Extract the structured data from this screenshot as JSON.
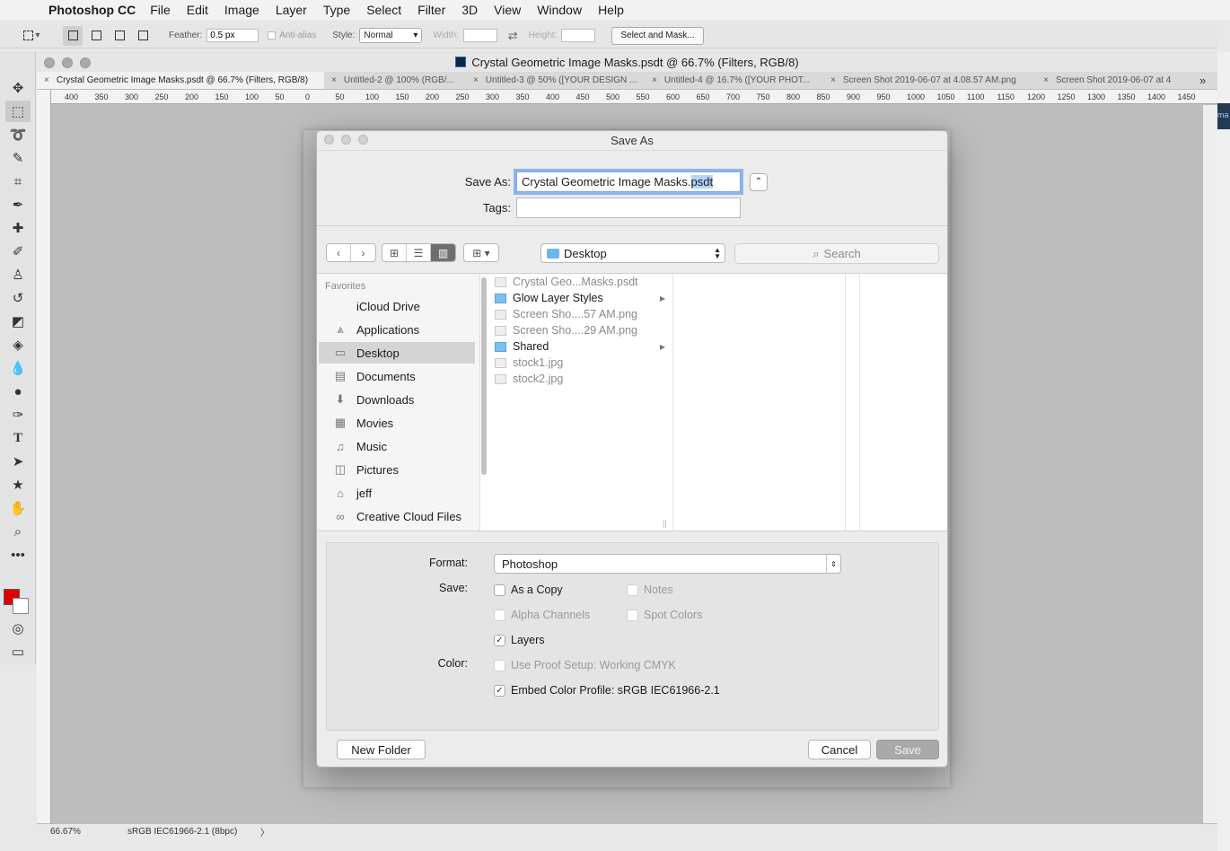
{
  "menubar": {
    "app": "Photoshop CC",
    "items": [
      "File",
      "Edit",
      "Image",
      "Layer",
      "Type",
      "Select",
      "Filter",
      "3D",
      "View",
      "Window",
      "Help"
    ]
  },
  "options": {
    "feather_label": "Feather:",
    "feather_value": "0.5 px",
    "antialias_label": "Anti-alias",
    "style_label": "Style:",
    "style_value": "Normal",
    "width_label": "Width:",
    "height_label": "Height:",
    "select_mask": "Select and Mask..."
  },
  "document": {
    "title": "Crystal Geometric Image Masks.psdt @ 66.7% (Filters, RGB/8)",
    "tabs": [
      "Crystal Geometric Image Masks.psdt @ 66.7% (Filters, RGB/8)",
      "Untitled-2 @ 100% (RGB/...",
      "Untitled-3 @ 50% ([YOUR DESIGN ...",
      "Untitled-4 @ 16.7% ([YOUR PHOT...",
      "Screen Shot 2019-06-07 at 4.08.57 AM.png",
      "Screen Shot 2019-06-07 at 4"
    ],
    "ruler": [
      "400",
      "350",
      "300",
      "250",
      "200",
      "150",
      "100",
      "50",
      "0",
      "50",
      "100",
      "150",
      "200",
      "250",
      "300",
      "350",
      "400",
      "450",
      "500",
      "550",
      "600",
      "650",
      "700",
      "750",
      "800",
      "850",
      "900",
      "950",
      "1000",
      "1050",
      "1100",
      "1150",
      "1200",
      "1250",
      "1300",
      "1350",
      "1400",
      "1450"
    ],
    "zoom": "66.67%",
    "profile": "sRGB IEC61966-2.1 (8bpc)",
    "right_edge": "ma"
  },
  "dialog": {
    "title": "Save As",
    "save_as_label": "Save As:",
    "filename_base": "Crystal Geometric Image Masks.",
    "filename_ext": "psdt",
    "tags_label": "Tags:",
    "location": "Desktop",
    "search_placeholder": "Search",
    "favorites_label": "Favorites",
    "sidebar": [
      {
        "label": "iCloud Drive",
        "icon": "cloud-icon"
      },
      {
        "label": "Applications",
        "icon": "applications-icon"
      },
      {
        "label": "Desktop",
        "icon": "desktop-icon"
      },
      {
        "label": "Documents",
        "icon": "documents-icon"
      },
      {
        "label": "Downloads",
        "icon": "downloads-icon"
      },
      {
        "label": "Movies",
        "icon": "movies-icon"
      },
      {
        "label": "Music",
        "icon": "music-icon"
      },
      {
        "label": "Pictures",
        "icon": "pictures-icon"
      },
      {
        "label": "jeff",
        "icon": "home-icon"
      },
      {
        "label": "Creative Cloud Files",
        "icon": "creative-cloud-icon"
      }
    ],
    "files": [
      {
        "name": "Crystal Geo...Masks.psdt",
        "kind": "file",
        "dim": true
      },
      {
        "name": "Glow Layer Styles",
        "kind": "folder",
        "dim": false
      },
      {
        "name": "Screen Sho....57 AM.png",
        "kind": "file",
        "dim": true
      },
      {
        "name": "Screen Sho....29 AM.png",
        "kind": "file",
        "dim": true
      },
      {
        "name": "Shared",
        "kind": "folder",
        "dim": false
      },
      {
        "name": "stock1.jpg",
        "kind": "file",
        "dim": true
      },
      {
        "name": "stock2.jpg",
        "kind": "file",
        "dim": true
      }
    ],
    "format_label": "Format:",
    "format_value": "Photoshop",
    "save_label": "Save:",
    "color_label": "Color:",
    "checkbox_labels": {
      "as_a_copy": "As a Copy",
      "notes": "Notes",
      "alpha": "Alpha Channels",
      "spot": "Spot Colors",
      "layers": "Layers",
      "proof": "Use Proof Setup:  Working CMYK",
      "embed": "Embed Color Profile:  sRGB IEC61966-2.1"
    },
    "new_folder": "New Folder",
    "cancel": "Cancel",
    "save": "Save"
  },
  "colors": {
    "foreground": "#e00000",
    "background": "#ffffff",
    "selection": "#b4d3f7"
  }
}
